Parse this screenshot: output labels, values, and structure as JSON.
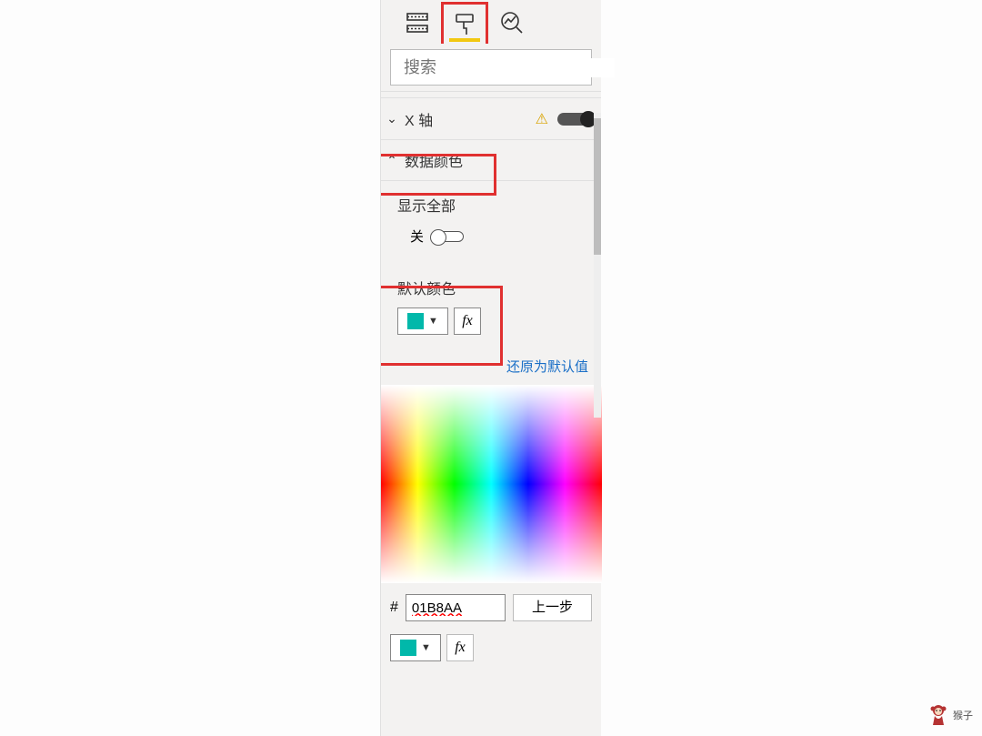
{
  "search": {
    "placeholder": "搜索"
  },
  "sections": {
    "x_axis": {
      "label": "X 轴"
    },
    "data_colors": {
      "label": "数据颜色"
    }
  },
  "show_all": {
    "label": "显示全部",
    "off_text": "关"
  },
  "default_color": {
    "label": "默认颜色",
    "fx": "fx",
    "swatch": "#01B8AA"
  },
  "reset": {
    "label": "还原为默认值"
  },
  "hex": {
    "hash": "#",
    "value": "01B8AA",
    "prev": "上一步"
  },
  "bottom": {
    "fx": "fx"
  },
  "watermark": {
    "text": "猴子"
  }
}
